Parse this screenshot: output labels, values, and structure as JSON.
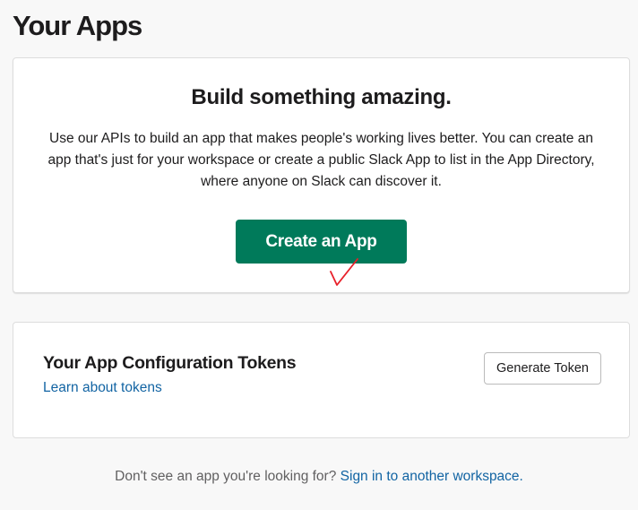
{
  "page": {
    "title": "Your Apps"
  },
  "hero": {
    "title": "Build something amazing.",
    "description": "Use our APIs to build an app that makes people's working lives better. You can create an app that's just for your workspace or create a public Slack App to list in the App Directory, where anyone on Slack can discover it.",
    "create_button_label": "Create an App",
    "button_color": "#007a5a",
    "annotation_icon": "red-checkmark-icon",
    "annotation_color": "#e8202a"
  },
  "tokens": {
    "title": "Your App Configuration Tokens",
    "learn_link": "Learn about tokens",
    "generate_button_label": "Generate Token"
  },
  "footer": {
    "prompt": "Don't see an app you're looking for?",
    "link": "Sign in to another workspace."
  },
  "colors": {
    "link": "#1264a3",
    "background": "#f8f8f8"
  }
}
